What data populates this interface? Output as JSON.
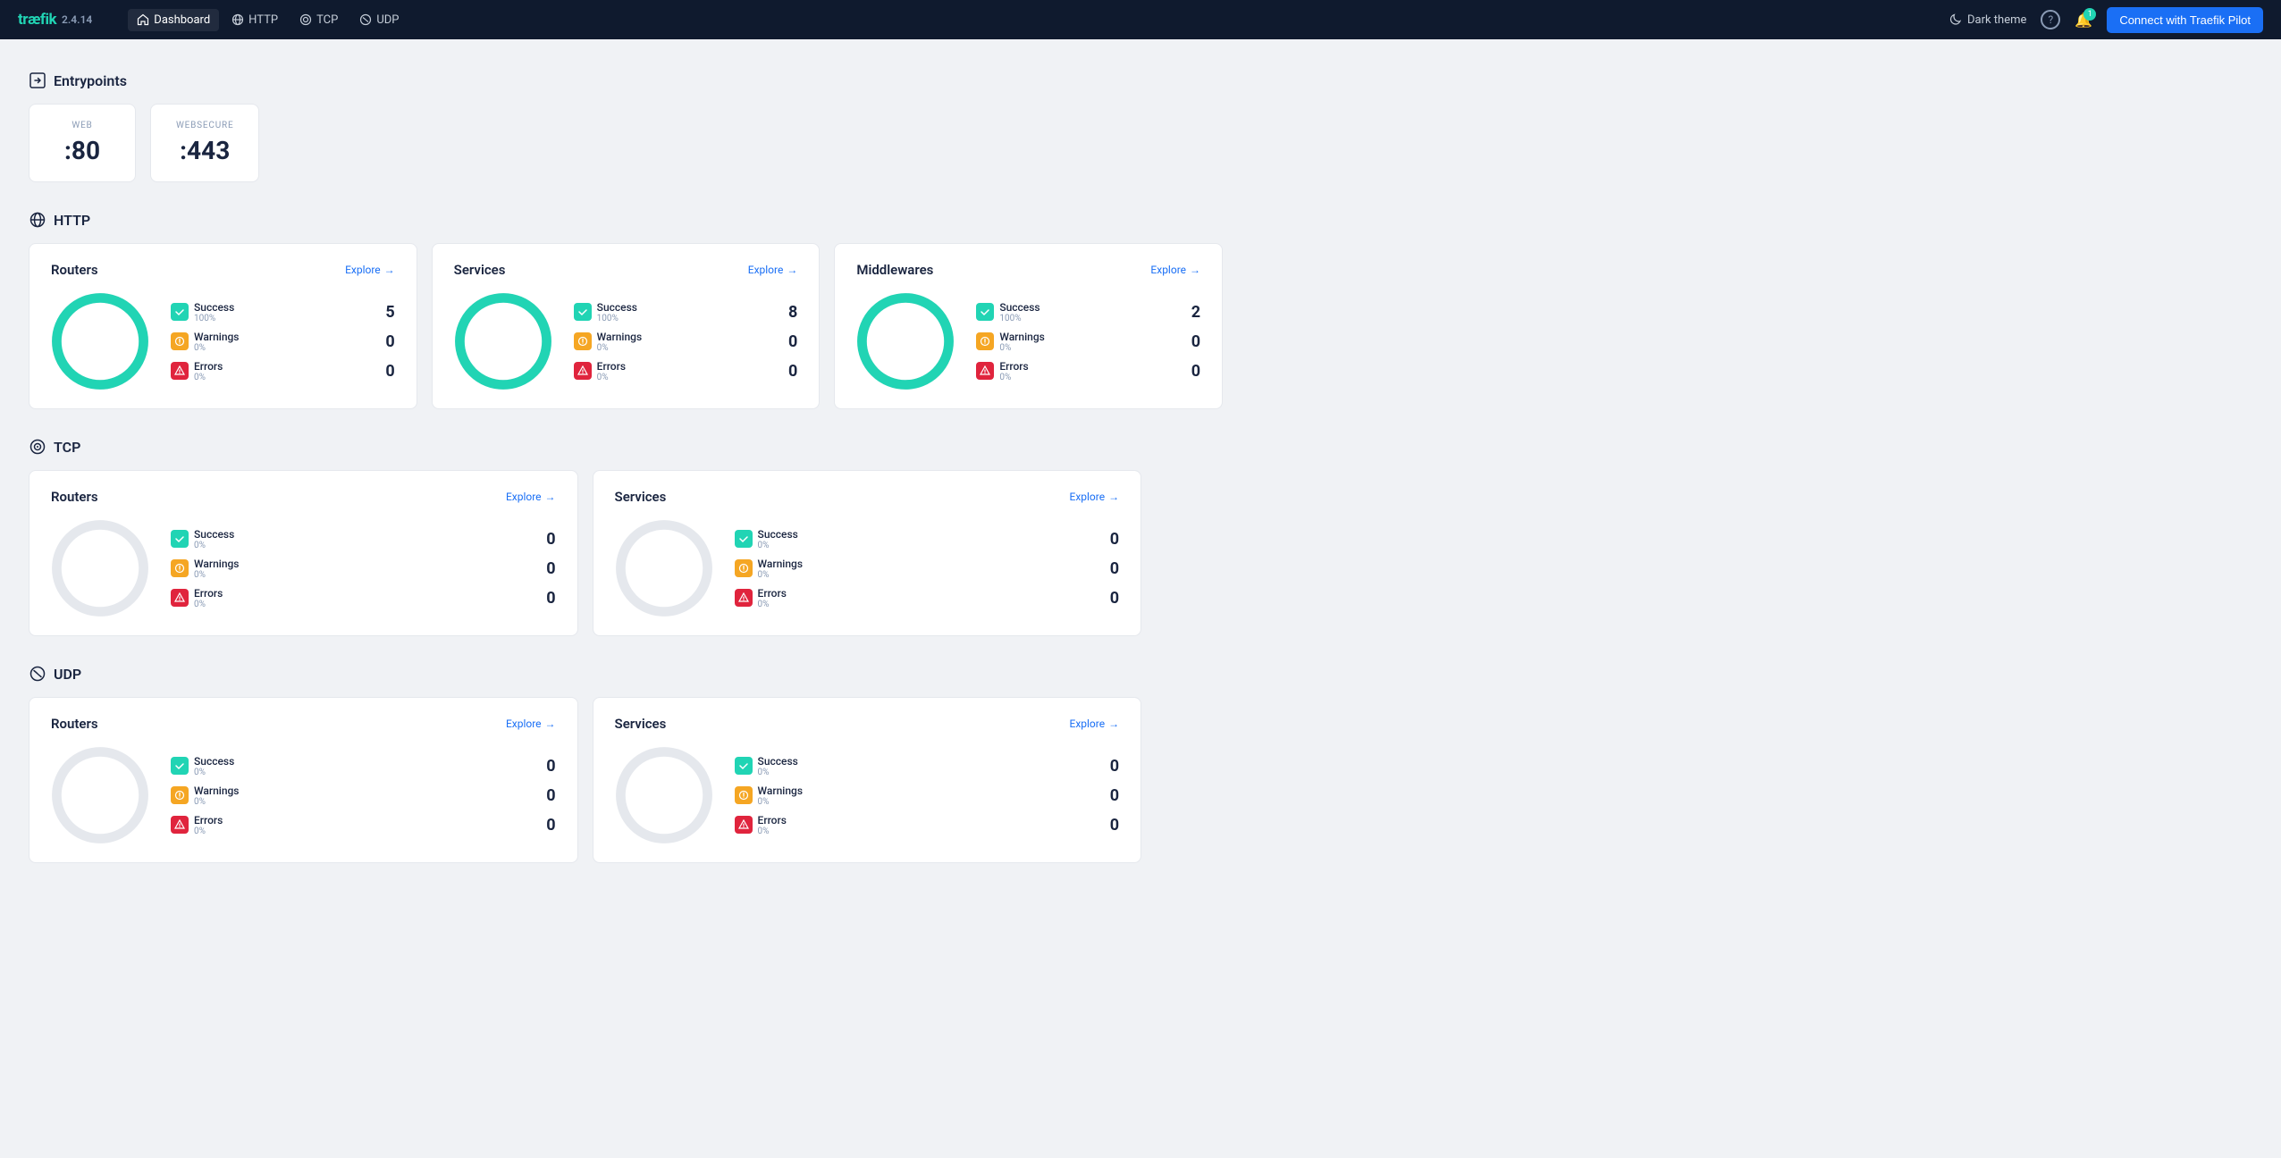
{
  "navbar": {
    "brand": "træfik",
    "brand_logo": "træfik",
    "version": "2.4.14",
    "links": [
      {
        "id": "dashboard",
        "label": "Dashboard",
        "active": true
      },
      {
        "id": "http",
        "label": "HTTP",
        "active": false
      },
      {
        "id": "tcp",
        "label": "TCP",
        "active": false
      },
      {
        "id": "udp",
        "label": "UDP",
        "active": false
      }
    ],
    "dark_theme": "Dark theme",
    "connect_btn": "Connect with Traefik Pilot",
    "notif_count": "1"
  },
  "entrypoints": {
    "section_label": "Entrypoints",
    "items": [
      {
        "label": "WEB",
        "value": ":80"
      },
      {
        "label": "WEBSECURE",
        "value": ":443"
      }
    ]
  },
  "http": {
    "section_label": "HTTP",
    "cards": [
      {
        "title": "Routers",
        "explore": "Explore",
        "has_data": true,
        "stats": [
          {
            "name": "Success",
            "pct": "100%",
            "count": 5,
            "type": "success"
          },
          {
            "name": "Warnings",
            "pct": "0%",
            "count": 0,
            "type": "warning"
          },
          {
            "name": "Errors",
            "pct": "0%",
            "count": 0,
            "type": "error"
          }
        ]
      },
      {
        "title": "Services",
        "explore": "Explore",
        "has_data": true,
        "stats": [
          {
            "name": "Success",
            "pct": "100%",
            "count": 8,
            "type": "success"
          },
          {
            "name": "Warnings",
            "pct": "0%",
            "count": 0,
            "type": "warning"
          },
          {
            "name": "Errors",
            "pct": "0%",
            "count": 0,
            "type": "error"
          }
        ]
      },
      {
        "title": "Middlewares",
        "explore": "Explore",
        "has_data": true,
        "stats": [
          {
            "name": "Success",
            "pct": "100%",
            "count": 2,
            "type": "success"
          },
          {
            "name": "Warnings",
            "pct": "0%",
            "count": 0,
            "type": "warning"
          },
          {
            "name": "Errors",
            "pct": "0%",
            "count": 0,
            "type": "error"
          }
        ]
      }
    ]
  },
  "tcp": {
    "section_label": "TCP",
    "cards": [
      {
        "title": "Routers",
        "explore": "Explore",
        "has_data": false,
        "stats": [
          {
            "name": "Success",
            "pct": "0%",
            "count": 0,
            "type": "success"
          },
          {
            "name": "Warnings",
            "pct": "0%",
            "count": 0,
            "type": "warning"
          },
          {
            "name": "Errors",
            "pct": "0%",
            "count": 0,
            "type": "error"
          }
        ]
      },
      {
        "title": "Services",
        "explore": "Explore",
        "has_data": false,
        "stats": [
          {
            "name": "Success",
            "pct": "0%",
            "count": 0,
            "type": "success"
          },
          {
            "name": "Warnings",
            "pct": "0%",
            "count": 0,
            "type": "warning"
          },
          {
            "name": "Errors",
            "pct": "0%",
            "count": 0,
            "type": "error"
          }
        ]
      }
    ]
  },
  "udp": {
    "section_label": "UDP",
    "cards": [
      {
        "title": "Routers",
        "explore": "Explore",
        "has_data": false,
        "stats": [
          {
            "name": "Success",
            "pct": "0%",
            "count": 0,
            "type": "success"
          },
          {
            "name": "Warnings",
            "pct": "0%",
            "count": 0,
            "type": "warning"
          },
          {
            "name": "Errors",
            "pct": "0%",
            "count": 0,
            "type": "error"
          }
        ]
      },
      {
        "title": "Services",
        "explore": "Explore",
        "has_data": false,
        "stats": [
          {
            "name": "Success",
            "pct": "0%",
            "count": 0,
            "type": "success"
          },
          {
            "name": "Warnings",
            "pct": "0%",
            "count": 0,
            "type": "warning"
          },
          {
            "name": "Errors",
            "pct": "0%",
            "count": 0,
            "type": "error"
          }
        ]
      }
    ]
  }
}
